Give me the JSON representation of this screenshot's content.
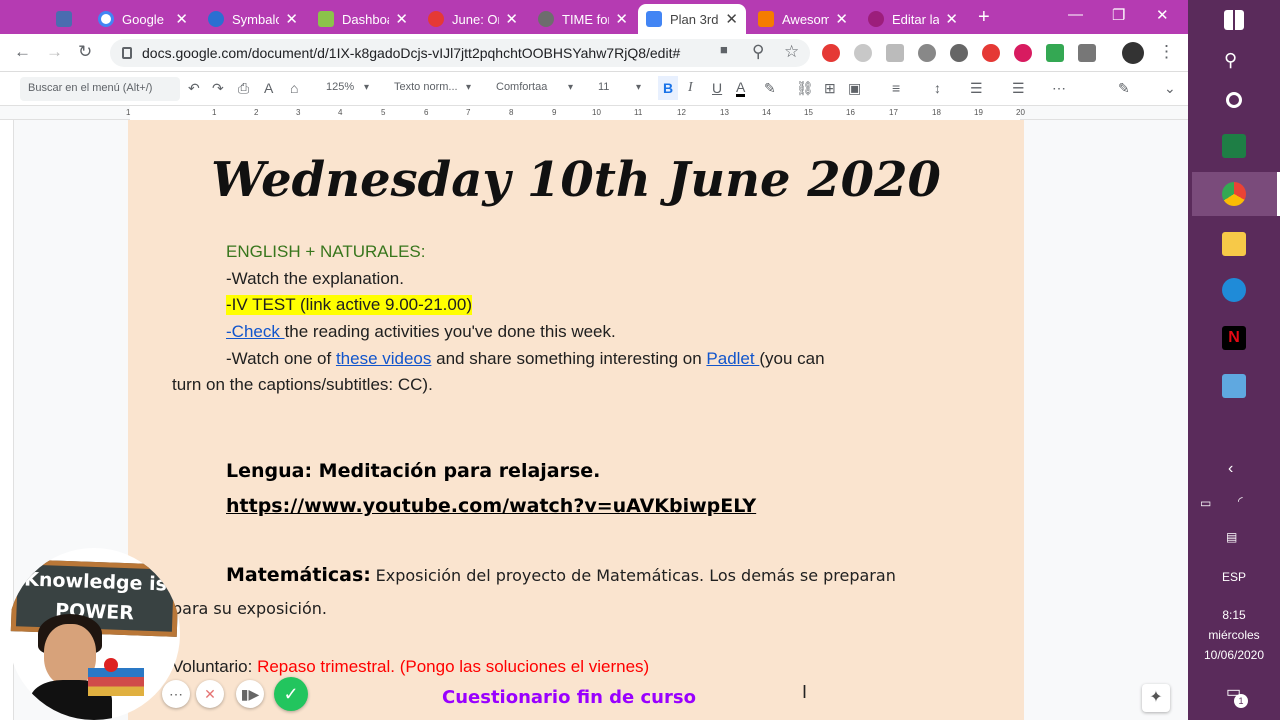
{
  "tabs": [
    {
      "title": "",
      "color": "#4a6cb0"
    },
    {
      "title": "Google",
      "color": "#4285f4"
    },
    {
      "title": "Symbalo",
      "color": "#2b6fd1"
    },
    {
      "title": "Dashboa",
      "color": "#8bc34a"
    },
    {
      "title": "June: On",
      "color": "#e53935"
    },
    {
      "title": "TIME for",
      "color": "#6d6d6d"
    },
    {
      "title": "Plan 3rd",
      "color": "#4285f4"
    },
    {
      "title": "Awesom",
      "color": "#f57c00"
    },
    {
      "title": "Editar la",
      "color": "#9c1e7b"
    }
  ],
  "address": {
    "url": "docs.google.com/document/d/1IX-k8gadoDcjs-vIJl7jtt2pqhchtOOBHSYahw7RjQ8/edit#"
  },
  "toolbar": {
    "search_placeholder": "Buscar en el menú (Alt+/)",
    "zoom": "125%",
    "style": "Texto norm...",
    "font": "Comfortaa",
    "size": "11"
  },
  "ruler": [
    "1",
    "1",
    "2",
    "3",
    "4",
    "5",
    "6",
    "7",
    "8",
    "9",
    "10",
    "11",
    "12",
    "13",
    "14",
    "15",
    "16",
    "17",
    "18",
    "19",
    "20"
  ],
  "document": {
    "title": "Wednesday 10th June 2020",
    "english_heading": "ENGLISH + NATURALES:",
    "line_watch": "-Watch the explanation.",
    "line_test": "-IV TEST (link active 9.00-21.00)",
    "check_link": "-Check ",
    "check_rest": "the reading activities you've done this week.",
    "watch2_a": "-Watch ",
    "watch2_b": "one of ",
    "these_videos": "these videos",
    "watch2_c": " and share something interesting on ",
    "padlet": "Padlet ",
    "watch2_d": "(you can",
    "watch2_e": "turn on the captions/subtitles: CC).",
    "lengua": "Lengua: Meditación para relajarse.",
    "lengua_link": "https://www.youtube.com/watch?v=uAVKbiwpELY",
    "mates_label": "Matemáticas:",
    "mates_text": "Exposición del proyecto de Matemáticas. Los demás se preparan",
    "mates_text2": "para su exposición.",
    "voluntario_label": "Voluntario: ",
    "voluntario_text": "Repaso trimestral. (Pongo las soluciones el viernes)",
    "cuestionario": "Cuestionario fin de curso"
  },
  "bitmoji": {
    "line1": "Knowledge is",
    "line2": "POWER"
  },
  "taskbar": {
    "lang": "ESP",
    "time": "8:15",
    "day": "miércoles",
    "date": "10/06/2020",
    "notif": "1"
  }
}
